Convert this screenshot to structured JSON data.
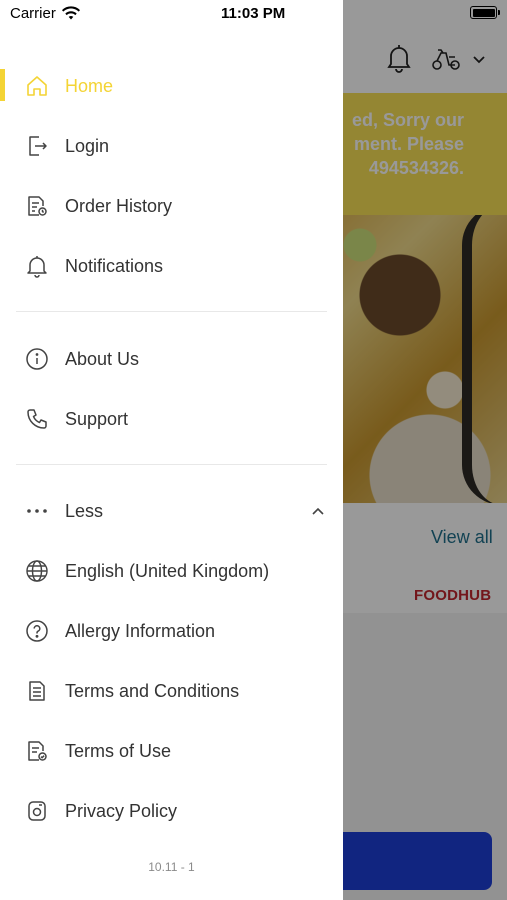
{
  "status_bar": {
    "carrier": "Carrier",
    "time": "11:03 PM"
  },
  "background": {
    "banner_lines": [
      "ed, Sorry our",
      "ment. Please",
      "494534326."
    ],
    "view_all": "View all",
    "brand": "FOODHUB",
    "colors": {
      "banner": "#f7df55",
      "view_all": "#1f6f8b",
      "brand": "#c0262d",
      "button": "#1d3fd6"
    }
  },
  "drawer": {
    "accent_color": "#f4d435",
    "items": [
      {
        "label": "Home",
        "icon": "home-icon",
        "active": true
      },
      {
        "label": "Login",
        "icon": "login-icon"
      },
      {
        "label": "Order History",
        "icon": "order-history-icon"
      },
      {
        "label": "Notifications",
        "icon": "bell-icon"
      },
      {
        "label": "About Us",
        "icon": "info-icon"
      },
      {
        "label": "Support",
        "icon": "phone-icon"
      },
      {
        "label": "Less",
        "icon": "more-dots-icon",
        "expanded": true
      },
      {
        "label": "English (United Kingdom)",
        "icon": "globe-icon"
      },
      {
        "label": "Allergy Information",
        "icon": "question-icon"
      },
      {
        "label": "Terms and Conditions",
        "icon": "document-icon"
      },
      {
        "label": "Terms of Use",
        "icon": "document-check-icon"
      },
      {
        "label": "Privacy Policy",
        "icon": "privacy-icon"
      }
    ],
    "version": "10.11 - 1"
  }
}
